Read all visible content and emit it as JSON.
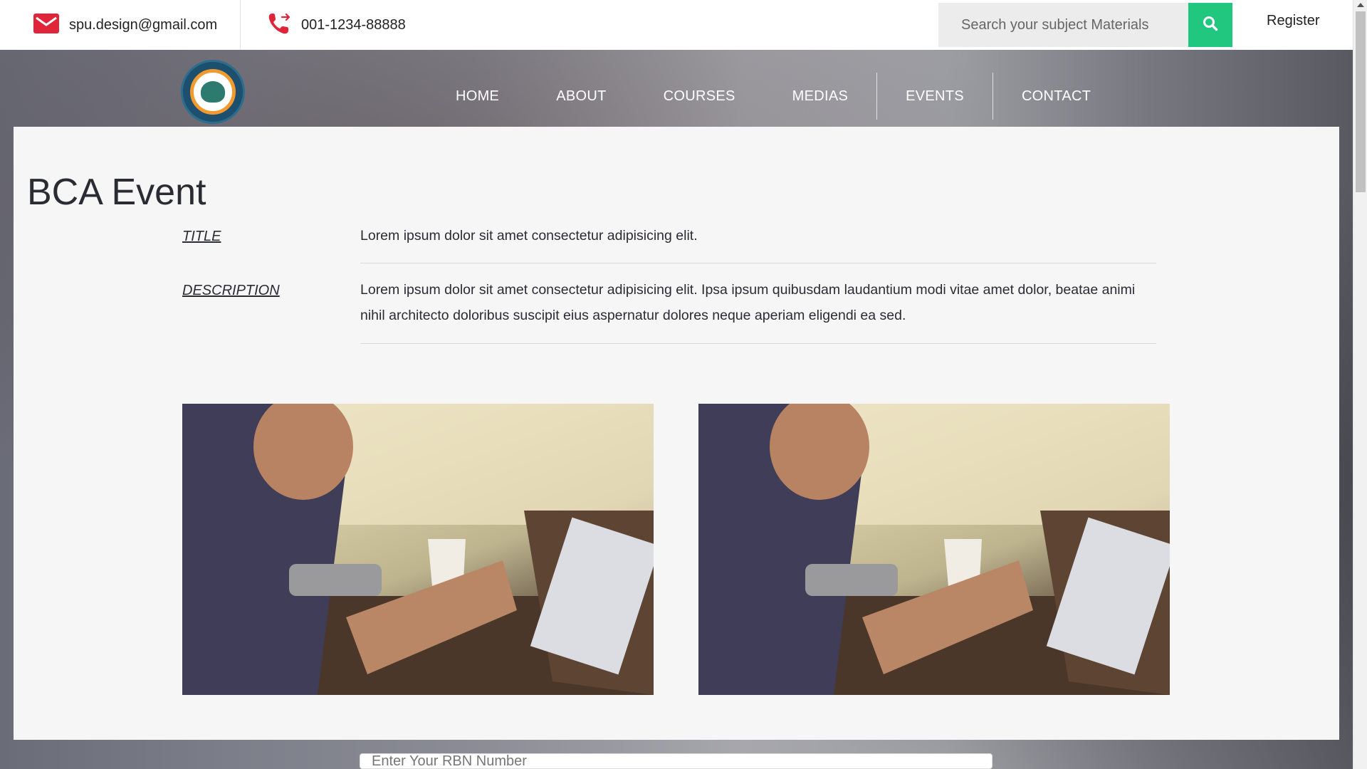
{
  "topbar": {
    "email": "spu.design@gmail.com",
    "phone": "001-1234-88888",
    "search_placeholder": "Search your subject Materials",
    "register_label": "Register"
  },
  "nav": {
    "items": [
      "HOME",
      "ABOUT",
      "COURSES",
      "MEDIAS",
      "EVENTS",
      "CONTACT"
    ]
  },
  "event": {
    "page_title": "BCA Event",
    "title_label": "TITLE",
    "title_value": "Lorem ipsum dolor sit amet consectetur adipisicing elit.",
    "description_label": "DESCRIPTION",
    "description_value": "Lorem ipsum dolor sit amet consectetur adipisicing elit. Ipsa ipsum quibusdam laudantium modi vitae amet dolor, beatae animi nihil architecto doloribus suscipit eius aspernatur dolores neque aperiam eligendi ea sed."
  },
  "footer_form": {
    "rbn_placeholder": "Enter Your RBN Number"
  },
  "colors": {
    "accent": "#21c77f",
    "icon_red": "#e0253a",
    "card_bg": "#f6f6f7",
    "text": "#2b2b33"
  },
  "icons": {
    "mail": "mail-icon",
    "phone": "phone-icon",
    "search": "search-icon"
  }
}
